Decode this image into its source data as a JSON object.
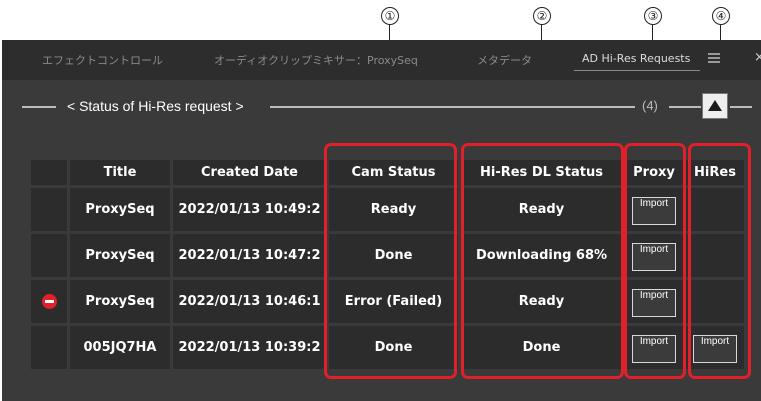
{
  "callouts": [
    "①",
    "②",
    "③",
    "④"
  ],
  "tabs": [
    "エフェクトコントロール",
    "オーディオクリップミキサー：ProxySeq",
    "メタデータ",
    "AD Hi-Res Requests"
  ],
  "icons": {
    "menu": "hamburger-menu-icon",
    "close": "close-icon",
    "collapse": "collapse-up-triangle-icon",
    "error": "error-minus-circle-icon"
  },
  "section": {
    "title": "< Status of Hi-Res request >",
    "count": "(4)"
  },
  "table": {
    "headers": [
      "",
      "Title",
      "Created Date",
      "Cam Status",
      "Hi-Res DL Status",
      "Proxy",
      "HiRes"
    ],
    "rows": [
      {
        "error": false,
        "title": "ProxySeq",
        "created": "2022/01/13 10:49:2",
        "cam_status": "Ready",
        "hires_status": "Ready",
        "proxy": "Import",
        "hires": ""
      },
      {
        "error": false,
        "title": "ProxySeq",
        "created": "2022/01/13 10:47:2",
        "cam_status": "Done",
        "hires_status": "Downloading 68%",
        "proxy": "Import",
        "hires": ""
      },
      {
        "error": true,
        "title": "ProxySeq",
        "created": "2022/01/13 10:46:1",
        "cam_status": "Error (Failed)",
        "hires_status": "Ready",
        "proxy": "Import",
        "hires": ""
      },
      {
        "error": false,
        "title": "005JQ7HA",
        "created": "2022/01/13 10:39:2",
        "cam_status": "Done",
        "hires_status": "Done",
        "proxy": "Import",
        "hires": "Import"
      }
    ]
  },
  "colors": {
    "panel": "#3a3a3a",
    "cell": "#2c2c2c",
    "highlight": "#e0202a",
    "done": "#c9c79a",
    "downloading": "#7aa7d8",
    "error": "#ff2020"
  }
}
